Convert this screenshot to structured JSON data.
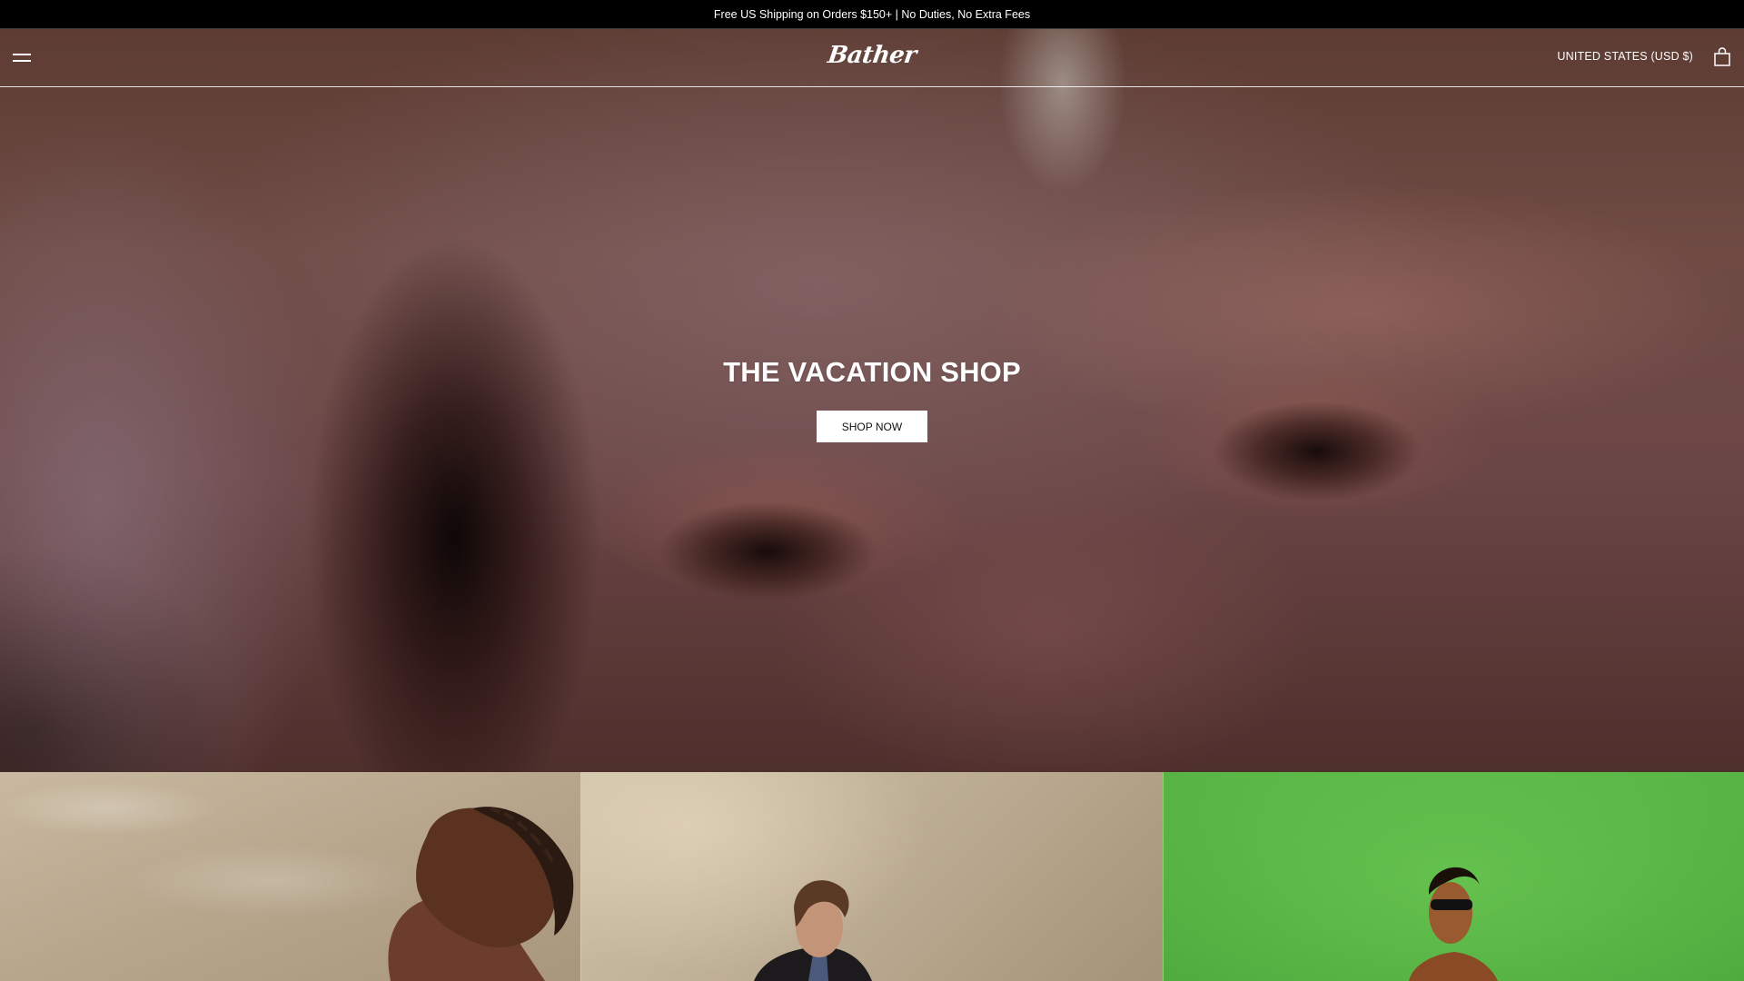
{
  "announcement": {
    "text": "Free US Shipping on Orders $150+ | No Duties, No Extra Fees"
  },
  "header": {
    "logo_text": "Bather",
    "country_selector": "UNITED STATES (USD $)",
    "menu_icon": "hamburger-menu-icon",
    "cart_icon": "shopping-bag-icon"
  },
  "hero": {
    "title": "THE VACATION SHOP",
    "button_label": "SHOP NOW"
  },
  "tiles": [
    {
      "name": "pool-portrait"
    },
    {
      "name": "studio-portrait"
    },
    {
      "name": "green-portrait"
    }
  ],
  "colors": {
    "announcement_bg": "#000000",
    "button_bg": "#ffffff",
    "button_text": "#111111",
    "tile_green": "#52b043"
  }
}
